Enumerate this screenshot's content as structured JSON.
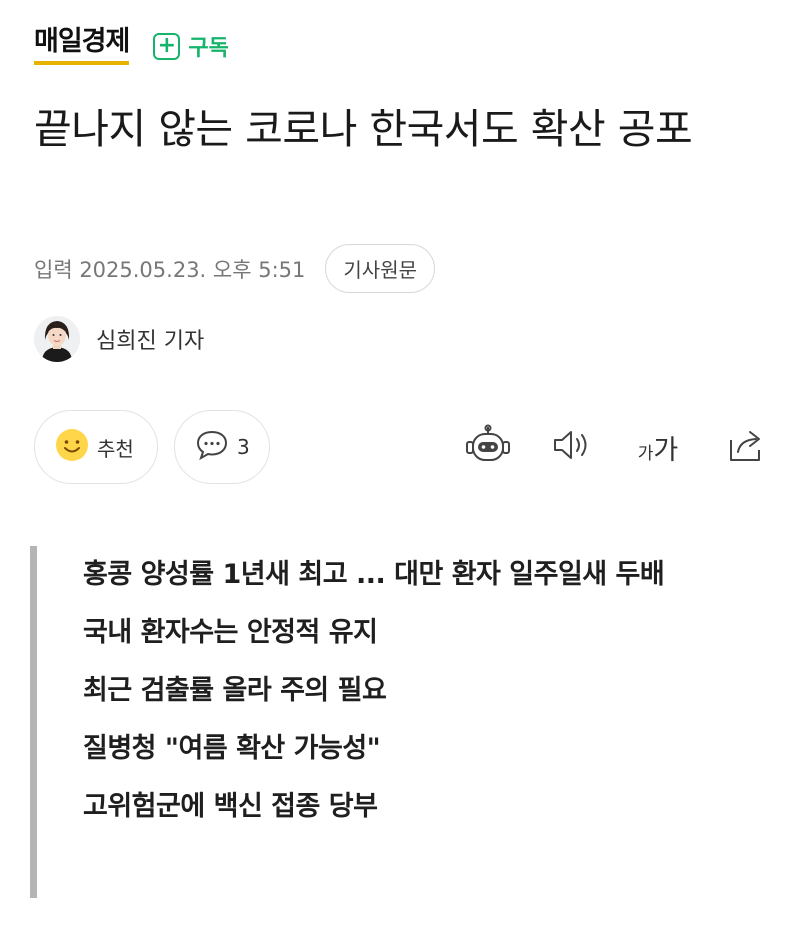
{
  "press": {
    "name": "매일경제",
    "subscribe_icon": "plus-icon",
    "subscribe_label": "구독",
    "brand_color": "#e5b300",
    "subscribe_color": "#16b46b"
  },
  "article": {
    "headline": "끝나지 않는 코로나 한국서도 확산 공포",
    "published": "입력 2025.05.23. 오후 5:51",
    "original_link_label": "기사원문",
    "reporter": "심희진 기자"
  },
  "actions": {
    "recommend_label": "추천",
    "recommend_icon": "smiley-icon",
    "comment_icon": "comment-bubble-icon",
    "comment_count": "3",
    "tools": [
      "ai-bot-icon",
      "audio-speaker-icon",
      "font-size-icon",
      "share-icon"
    ],
    "font_small": "가",
    "font_large": "가"
  },
  "summary": [
    "홍콩 양성률 1년새 최고 ... 대만 환자 일주일새 두배",
    "국내 환자수는 안정적 유지",
    "최근 검출률 올라 주의 필요",
    "질병청 \"여름 확산 가능성\"",
    "고위험군에 백신 접종 당부"
  ]
}
